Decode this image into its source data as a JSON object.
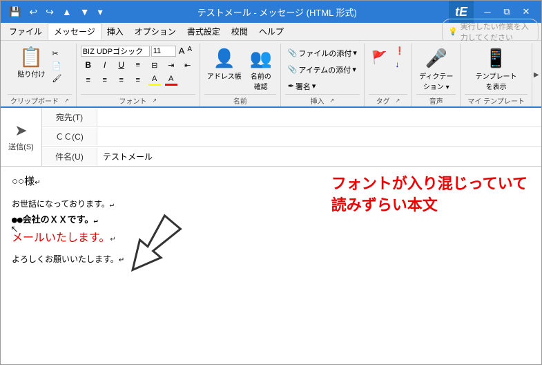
{
  "titleBar": {
    "title": "テストメール - メッセージ (HTML 形式)",
    "saveIcon": "💾",
    "undoIcon": "↩",
    "redoIcon": "↪",
    "upIcon": "▲",
    "downIcon": "▼",
    "outlookLetter": "tE",
    "minBtn": "─",
    "maxBtn": "□",
    "closeBtn": "✕",
    "restoreBtn": "⧉"
  },
  "menuBar": {
    "items": [
      {
        "label": "ファイル",
        "active": false
      },
      {
        "label": "メッセージ",
        "active": true
      },
      {
        "label": "挿入",
        "active": false
      },
      {
        "label": "オプション",
        "active": false
      },
      {
        "label": "書式設定",
        "active": false
      },
      {
        "label": "校閲",
        "active": false
      },
      {
        "label": "ヘルプ",
        "active": false
      }
    ],
    "searchPlaceholder": "実行したい作業を入力してください",
    "searchIcon": "💡"
  },
  "ribbon": {
    "groups": [
      {
        "name": "clipboard",
        "label": "クリップボード",
        "items": [
          {
            "type": "large",
            "icon": "📋",
            "label": "貼り付け"
          },
          {
            "type": "small-col",
            "items": [
              {
                "icon": "✂",
                "label": ""
              },
              {
                "icon": "📄",
                "label": ""
              },
              {
                "icon": "🖌",
                "label": ""
              }
            ]
          }
        ]
      },
      {
        "name": "font",
        "label": "フォント",
        "fontName": "BIZ UDPゴシック",
        "fontSize": "11",
        "boldLabel": "B",
        "italicLabel": "I",
        "underlineLabel": "U",
        "highlightColor": "#FFFF00",
        "fontColor": "#FF0000"
      },
      {
        "name": "names",
        "label": "名前",
        "items": [
          {
            "type": "large",
            "icon": "👤",
            "label": "アドレス帳"
          },
          {
            "type": "large",
            "icon": "👥",
            "label": "名前の\n確認"
          }
        ]
      },
      {
        "name": "insert",
        "label": "挿入",
        "items": [
          {
            "label": "📎 ファイルの添付 ▾"
          },
          {
            "label": "📎 アイテムの添付 ▾"
          },
          {
            "label": "✒ 署名 ▾"
          }
        ]
      },
      {
        "name": "tags",
        "label": "タグ",
        "items": [
          {
            "icon": "🚩",
            "label": ""
          },
          {
            "icon": "❗",
            "label": ""
          },
          {
            "icon": "↓",
            "label": ""
          }
        ],
        "expandIcon": "↗"
      },
      {
        "name": "voice",
        "label": "音声",
        "items": [
          {
            "type": "large",
            "icon": "🎤",
            "label": "ディクテー\nション ▾"
          }
        ]
      },
      {
        "name": "myTemplates",
        "label": "マイ テンプレート",
        "items": [
          {
            "type": "large",
            "icon": "📱",
            "label": "テンプレート\nを表示"
          }
        ]
      }
    ],
    "scrollRight": "▶"
  },
  "emailForm": {
    "toLabel": "宛先(T)",
    "toValue": "",
    "ccLabel": "ＣＣ(C)",
    "ccValue": "",
    "subjectLabel": "件名(U)",
    "subjectValue": "テストメール",
    "sendLabel": "送信(S)",
    "sendIconChar": "➤"
  },
  "emailBody": {
    "lines": [
      {
        "text": "○○様↵",
        "style": "salutation"
      },
      {
        "text": "",
        "style": "spacer"
      },
      {
        "text": "お世話になっております。↵",
        "style": "formal"
      },
      {
        "text": "●●会社のＸＸです。↵",
        "style": "company"
      },
      {
        "text": "メールいたします。↵",
        "style": "red-text"
      },
      {
        "text": "",
        "style": "spacer"
      },
      {
        "text": "よろしくお願いいたします。↵",
        "style": "closing"
      }
    ],
    "annotation": {
      "line1": "フォントが入り混じっていて",
      "line2": "読みずらい本文"
    }
  }
}
